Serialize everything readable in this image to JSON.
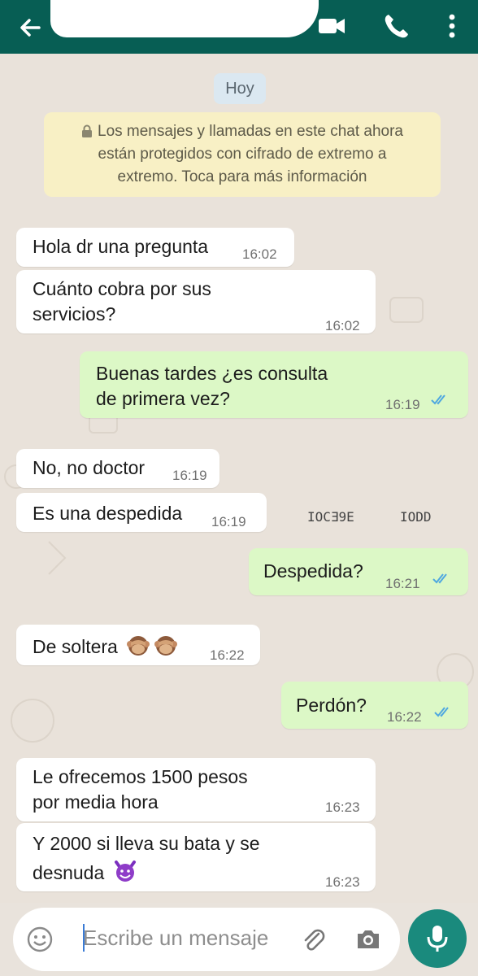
{
  "header": {
    "back_icon": "arrow-left-icon",
    "actions": [
      "video-call-icon",
      "voice-call-icon",
      "more-vertical-icon"
    ],
    "colors": {
      "bar": "#075e54"
    }
  },
  "chat": {
    "day_label": "Hoy",
    "encryption_notice": {
      "line1": "Los mensajes y llamadas en este chat ahora",
      "line2": "están protegidos con cifrado de extremo a",
      "line3": "extremo. Toca para más información"
    },
    "messages": [
      {
        "dir": "in",
        "lines": [
          "Hola dr una pregunta"
        ],
        "time": "16:02"
      },
      {
        "dir": "in",
        "lines": [
          "Cuánto cobra por sus",
          "servicios?"
        ],
        "time": "16:02"
      },
      {
        "dir": "out",
        "lines": [
          "Buenas tardes ¿es consulta",
          "de primera vez?"
        ],
        "time": "16:19",
        "status": "read"
      },
      {
        "dir": "in",
        "lines": [
          "No, no doctor"
        ],
        "time": "16:19"
      },
      {
        "dir": "in",
        "lines": [
          "Es una despedida"
        ],
        "time": "16:19"
      },
      {
        "dir": "out",
        "lines": [
          "Despedida?"
        ],
        "time": "16:21",
        "status": "read"
      },
      {
        "dir": "in",
        "lines": [
          "De soltera"
        ],
        "time": "16:22",
        "emoji": "see-no-evil-monkey x2"
      },
      {
        "dir": "out",
        "lines": [
          "Perdón?"
        ],
        "time": "16:22",
        "status": "read"
      },
      {
        "dir": "in",
        "lines": [
          "Le ofrecemos 1500 pesos",
          "por media hora"
        ],
        "time": "16:23"
      },
      {
        "dir": "in",
        "lines": [
          "Y 2000 si lleva su bata y se",
          "desnuda"
        ],
        "time": "16:23",
        "emoji": "smiling-devil"
      }
    ],
    "artifacts": {
      "a": "IOCƎ9E",
      "b": "IODD"
    },
    "colors": {
      "incoming": "#ffffff",
      "outgoing": "#dcf8c6",
      "read_ticks": "#4fa8e0"
    }
  },
  "composer": {
    "placeholder": "Escribe un mensaje",
    "icons": [
      "emoji-icon",
      "attach-icon",
      "camera-icon",
      "mic-icon"
    ],
    "accent": "#1a8a7d"
  }
}
